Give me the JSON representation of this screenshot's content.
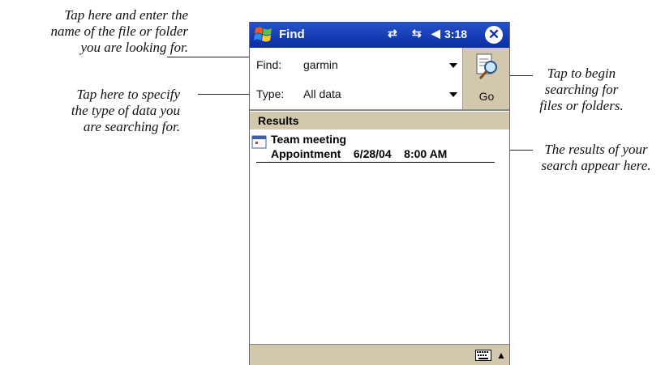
{
  "annotations": {
    "find_field": [
      "Tap here and enter the",
      "name of the file or folder",
      "you are looking for."
    ],
    "type_field": [
      "Tap here to specify",
      "the type of data you",
      "are searching for."
    ],
    "go_button": [
      "Tap to begin",
      "searching for",
      "files or folders."
    ],
    "results": [
      "The results of your",
      "search appear here."
    ]
  },
  "titlebar": {
    "title": "Find",
    "clock": "3:18",
    "close_label": "✕",
    "icons": [
      "start-flag-icon",
      "connectivity-icon",
      "sync-icon",
      "volume-icon",
      "close-icon"
    ]
  },
  "form": {
    "find_label": "Find:",
    "find_value": "garmin",
    "type_label": "Type:",
    "type_value": "All data",
    "go_label": "Go"
  },
  "results": {
    "header": "Results",
    "items": [
      {
        "title": "Team meeting",
        "category": "Appointment",
        "date": "6/28/04",
        "time": "8:00 AM"
      }
    ]
  },
  "colors": {
    "titlebar": "#0a2ea6",
    "panel": "#d2c8ae",
    "text": "#111111"
  }
}
